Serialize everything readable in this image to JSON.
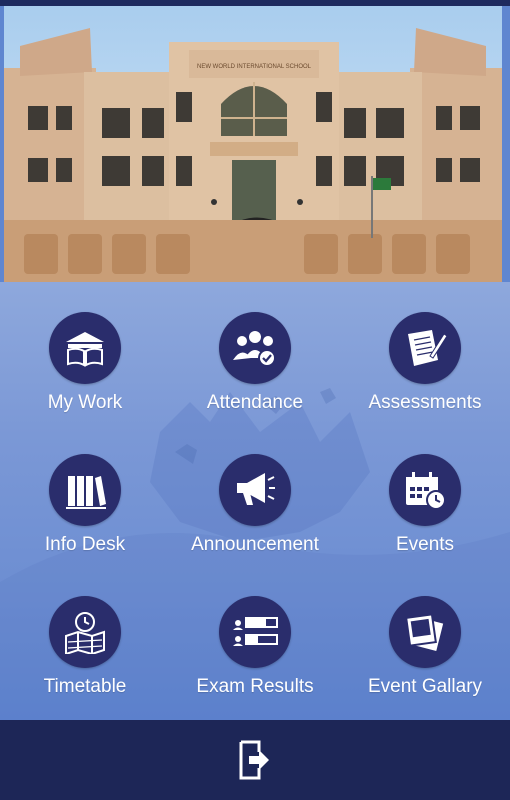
{
  "header": {
    "photo": "school-building-photo",
    "sign_text": "NEW WORLD INTERNATIONAL SCHOOL"
  },
  "tiles": [
    {
      "label": "My Work",
      "icon": "book-icon"
    },
    {
      "label": "Attendance",
      "icon": "group-check-icon"
    },
    {
      "label": "Assessments",
      "icon": "paper-pen-icon"
    },
    {
      "label": "Info Desk",
      "icon": "books-icon"
    },
    {
      "label": "Announcement",
      "icon": "megaphone-icon"
    },
    {
      "label": "Events",
      "icon": "calendar-clock-icon"
    },
    {
      "label": "Timetable",
      "icon": "map-clock-icon"
    },
    {
      "label": "Exam Results",
      "icon": "results-list-icon"
    },
    {
      "label": "Event Gallary",
      "icon": "photos-icon"
    }
  ],
  "bottom_bar": {
    "icon": "logout-icon"
  },
  "colors": {
    "icon_circle": "#2a2d6c",
    "bottom_bar": "#1d2657",
    "background": "#6d8ed2",
    "label": "#ffffff"
  }
}
